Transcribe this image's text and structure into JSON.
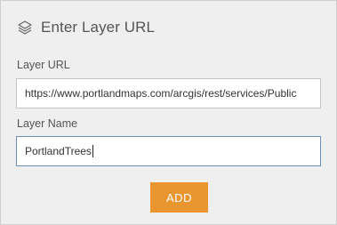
{
  "header": {
    "icon": "layers-icon",
    "title": "Enter Layer URL"
  },
  "layer_url": {
    "label": "Layer URL",
    "value": "https://www.portlandmaps.com/arcgis/rest/services/Public"
  },
  "layer_name": {
    "label": "Layer Name",
    "value": "PortlandTrees"
  },
  "add_button": {
    "label": "ADD",
    "color": "#e99631"
  }
}
